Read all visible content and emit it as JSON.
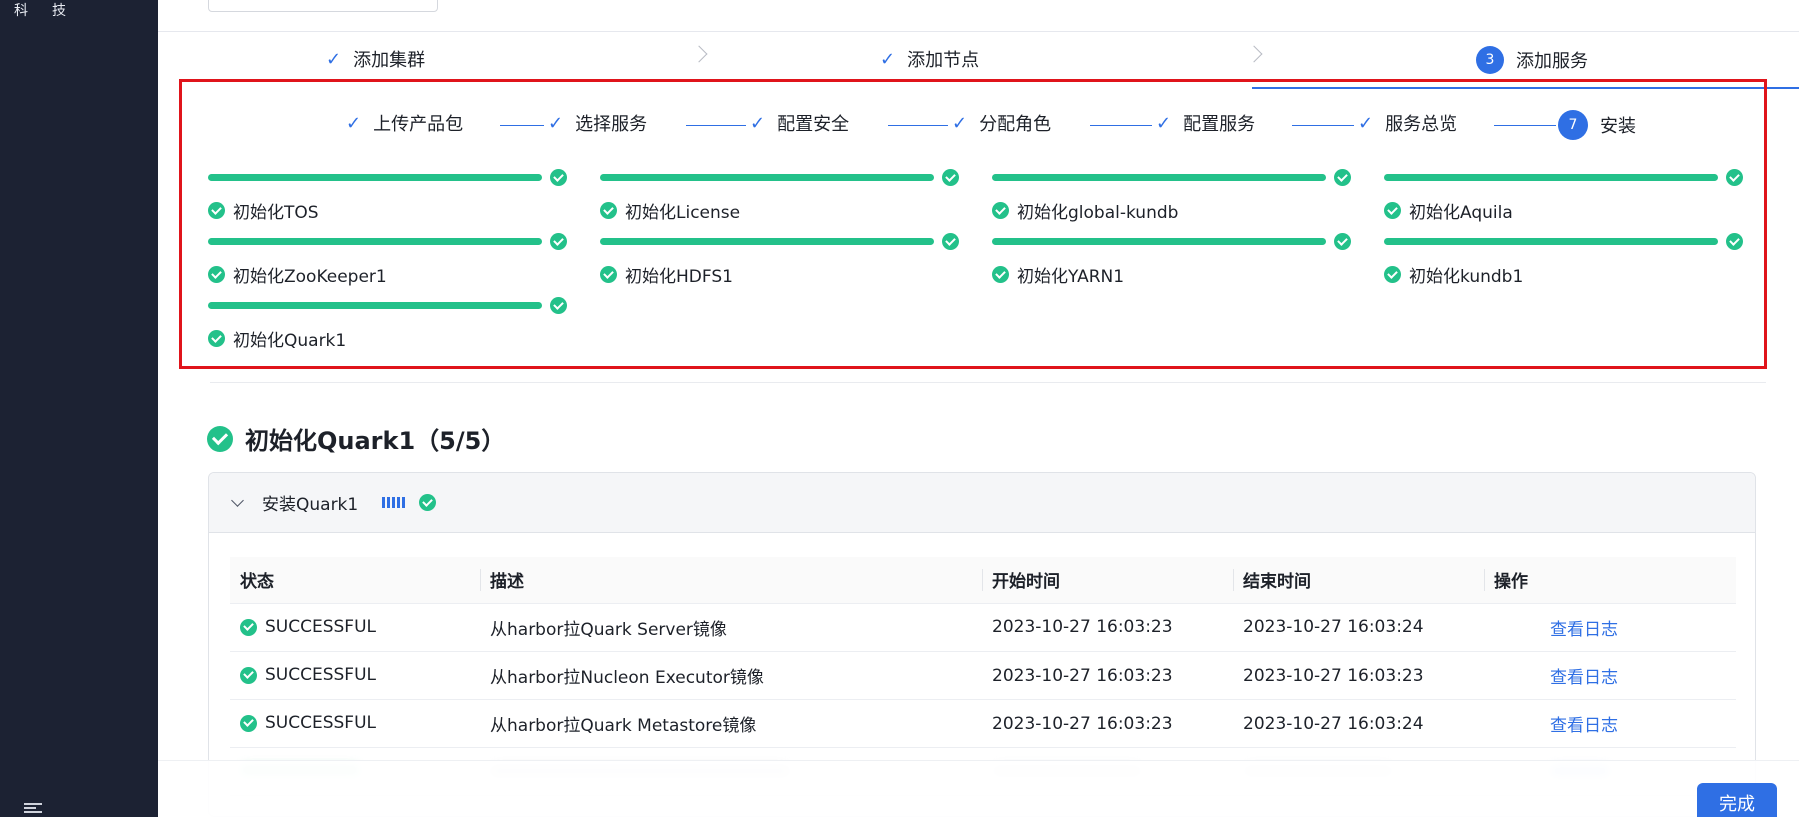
{
  "sidebar": {
    "brand": "科技"
  },
  "steps_main": [
    {
      "label": "添加集群",
      "done": true
    },
    {
      "label": "添加节点",
      "done": true
    },
    {
      "label": "添加服务",
      "done": false,
      "number": "3"
    }
  ],
  "sub_steps": [
    {
      "label": "上传产品包",
      "done": true
    },
    {
      "label": "选择服务",
      "done": true
    },
    {
      "label": "配置安全",
      "done": true
    },
    {
      "label": "分配角色",
      "done": true
    },
    {
      "label": "配置服务",
      "done": true
    },
    {
      "label": "服务总览",
      "done": true
    },
    {
      "label": "安装",
      "done": false,
      "number": "7"
    }
  ],
  "tasks": [
    {
      "label": "初始化TOS",
      "progress": 1.0
    },
    {
      "label": "初始化License",
      "progress": 1.0
    },
    {
      "label": "初始化global-kundb",
      "progress": 1.0
    },
    {
      "label": "初始化Aquila",
      "progress": 1.0
    },
    {
      "label": "初始化ZooKeeper1",
      "progress": 1.0
    },
    {
      "label": "初始化HDFS1",
      "progress": 1.0
    },
    {
      "label": "初始化YARN1",
      "progress": 1.0
    },
    {
      "label": "初始化kundb1",
      "progress": 1.0
    },
    {
      "label": "初始化Quark1",
      "progress": 1.0
    }
  ],
  "section": {
    "title": "初始化Quark1（5/5）"
  },
  "panel": {
    "title": "安装Quark1"
  },
  "table": {
    "headers": [
      "状态",
      "描述",
      "开始时间",
      "结束时间",
      "操作"
    ],
    "rows": [
      {
        "status": "SUCCESSFUL",
        "desc": "从harbor拉Quark Server镜像",
        "start": "2023-10-27 16:03:23",
        "end": "2023-10-27 16:03:24",
        "action": "查看日志"
      },
      {
        "status": "SUCCESSFUL",
        "desc": "从harbor拉Nucleon Executor镜像",
        "start": "2023-10-27 16:03:23",
        "end": "2023-10-27 16:03:23",
        "action": "查看日志"
      },
      {
        "status": "SUCCESSFUL",
        "desc": "从harbor拉Quark Metastore镜像",
        "start": "2023-10-27 16:03:23",
        "end": "2023-10-27 16:03:24",
        "action": "查看日志"
      }
    ]
  },
  "footer": {
    "finish_label": "完成"
  },
  "colors": {
    "accent": "#2f6fe4",
    "success": "#23c18a",
    "highlight_border": "#e0141b",
    "sidebar": "#1c2233"
  }
}
